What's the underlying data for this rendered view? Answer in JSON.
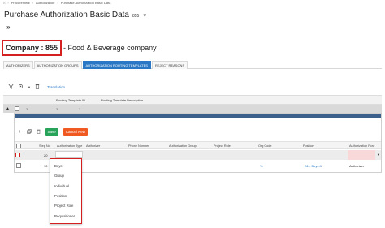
{
  "breadcrumb": {
    "home_icon": "home-icon",
    "items": [
      "Procurement",
      "Authorization",
      "Purchase Authorization Basic Data"
    ]
  },
  "page": {
    "title": "Purchase Authorization Basic Data",
    "company_number": "855"
  },
  "company": {
    "label": "Company : 855",
    "name": "Food & Beverage company"
  },
  "tabs": [
    {
      "label": "AUTHORIZERS",
      "active": false
    },
    {
      "label": "AUTHORIZATION GROUPS",
      "active": false
    },
    {
      "label": "AUTHORIZATION ROUTING TEMPLATES",
      "active": true
    },
    {
      "label": "REJECT REASONS",
      "active": false
    }
  ],
  "toolbar": {
    "translation_link": "Translation"
  },
  "outer_table": {
    "headers": {
      "template_id": "Routing Template ID",
      "description": "Routing Template Description"
    },
    "row": {
      "col1": "1",
      "template_id": "1",
      "description": "1"
    }
  },
  "child": {
    "save_label": "Save",
    "cancel_label": "Cancel New",
    "headers": {
      "step_no": "Step No",
      "auth_type": "Authorization Type",
      "authorizer": "Authorizer",
      "phone": "Phone Number",
      "auth_group": "Authorization Group",
      "project_role": "Project Role",
      "org_code": "Org Code",
      "position": "Position",
      "auth_flow": "Authorization Flow"
    },
    "row1": {
      "step_no": "20"
    },
    "row2": {
      "step_no": "10",
      "org_code": "%",
      "position": "B1 - Buyer1",
      "auth_flow": "Authorizer"
    }
  },
  "dropdown": {
    "options": [
      "Buyer",
      "Group",
      "Individual",
      "Position",
      "Project Role",
      "Requisitioner"
    ]
  },
  "colors": {
    "accent": "#2a78c5",
    "save": "#27a35a",
    "cancel": "#f05a22",
    "highlight": "#d42020"
  }
}
